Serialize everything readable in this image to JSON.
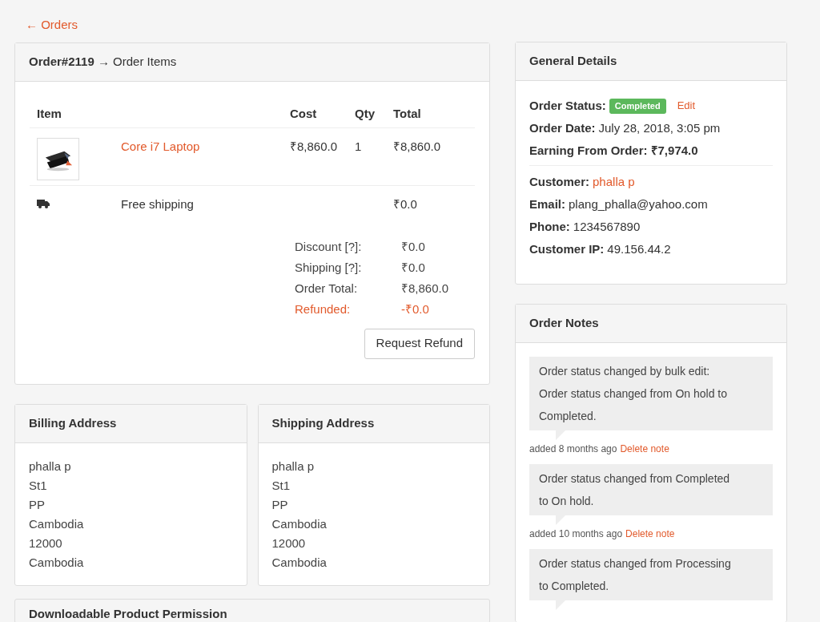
{
  "back_link": "← Orders",
  "order_items": {
    "title": "**Order#2119** → Order Items",
    "columns": [
      {
        "label": "Item",
        "kind": "item"
      },
      {
        "label": "Cost",
        "kind": "cost"
      },
      {
        "label": "Qty",
        "kind": "qty"
      },
      {
        "label": "Total",
        "kind": "total"
      }
    ],
    "rows": [
      {
        "kind": "product",
        "name": "Core i7 Laptop",
        "cost": "₹8,860.0",
        "qty": "1",
        "total": "₹8,860.0"
      },
      {
        "kind": "shipping",
        "name": "Free shipping",
        "total": "₹0.0"
      }
    ],
    "totals": [
      {
        "label": "Discount [?]:",
        "value": "₹0.0",
        "highlight": false
      },
      {
        "label": "Shipping [?]:",
        "value": "₹0.0",
        "highlight": false
      },
      {
        "label": "Order Total:",
        "value": "₹8,860.0",
        "highlight": false
      },
      {
        "label": "Refunded:",
        "value": "-₹0.0",
        "highlight": true
      }
    ],
    "button": "Request Refund"
  },
  "addresses": [
    {
      "title": "Billing Address",
      "lines": [
        "phalla p",
        "St1",
        "PP",
        "Cambodia",
        "12000",
        "Cambodia"
      ]
    },
    {
      "title": "Shipping Address",
      "lines": [
        "phalla p",
        "St1",
        "PP",
        "Cambodia",
        "12000",
        "Cambodia"
      ]
    }
  ],
  "downloads": {
    "title": "Downloadable Product Permission"
  },
  "general_details": {
    "title": "General Details",
    "groups": [
      [
        {
          "label": "Order Status:",
          "kind": "badge",
          "value": "Completed",
          "action": "Edit"
        },
        {
          "label": "Order Date:",
          "kind": "text",
          "value": "July 28, 2018, 3:05 pm"
        },
        {
          "label": "Earning From Order:",
          "kind": "bold",
          "value": "₹7,974.0"
        }
      ],
      [
        {
          "label": "Customer:",
          "kind": "link",
          "value": "phalla p"
        },
        {
          "label": "Email:",
          "kind": "text",
          "value": "plang_phalla@yahoo.com"
        },
        {
          "label": "Phone:",
          "kind": "text",
          "value": "1234567890"
        },
        {
          "label": "Customer IP:",
          "kind": "text",
          "value": "49.156.44.2"
        }
      ]
    ]
  },
  "order_notes": {
    "title": "Order Notes",
    "notes": [
      {
        "lines": [
          "Order status changed by bulk edit:",
          "Order status changed from On hold to",
          "Completed."
        ],
        "meta": "added 8 months ago",
        "action": "Delete note"
      },
      {
        "lines": [
          "Order status changed from Completed",
          "to On hold."
        ],
        "meta": "added 10 months ago",
        "action": "Delete note"
      },
      {
        "lines": [
          "Order status changed from Processing",
          "to Completed."
        ]
      }
    ]
  }
}
